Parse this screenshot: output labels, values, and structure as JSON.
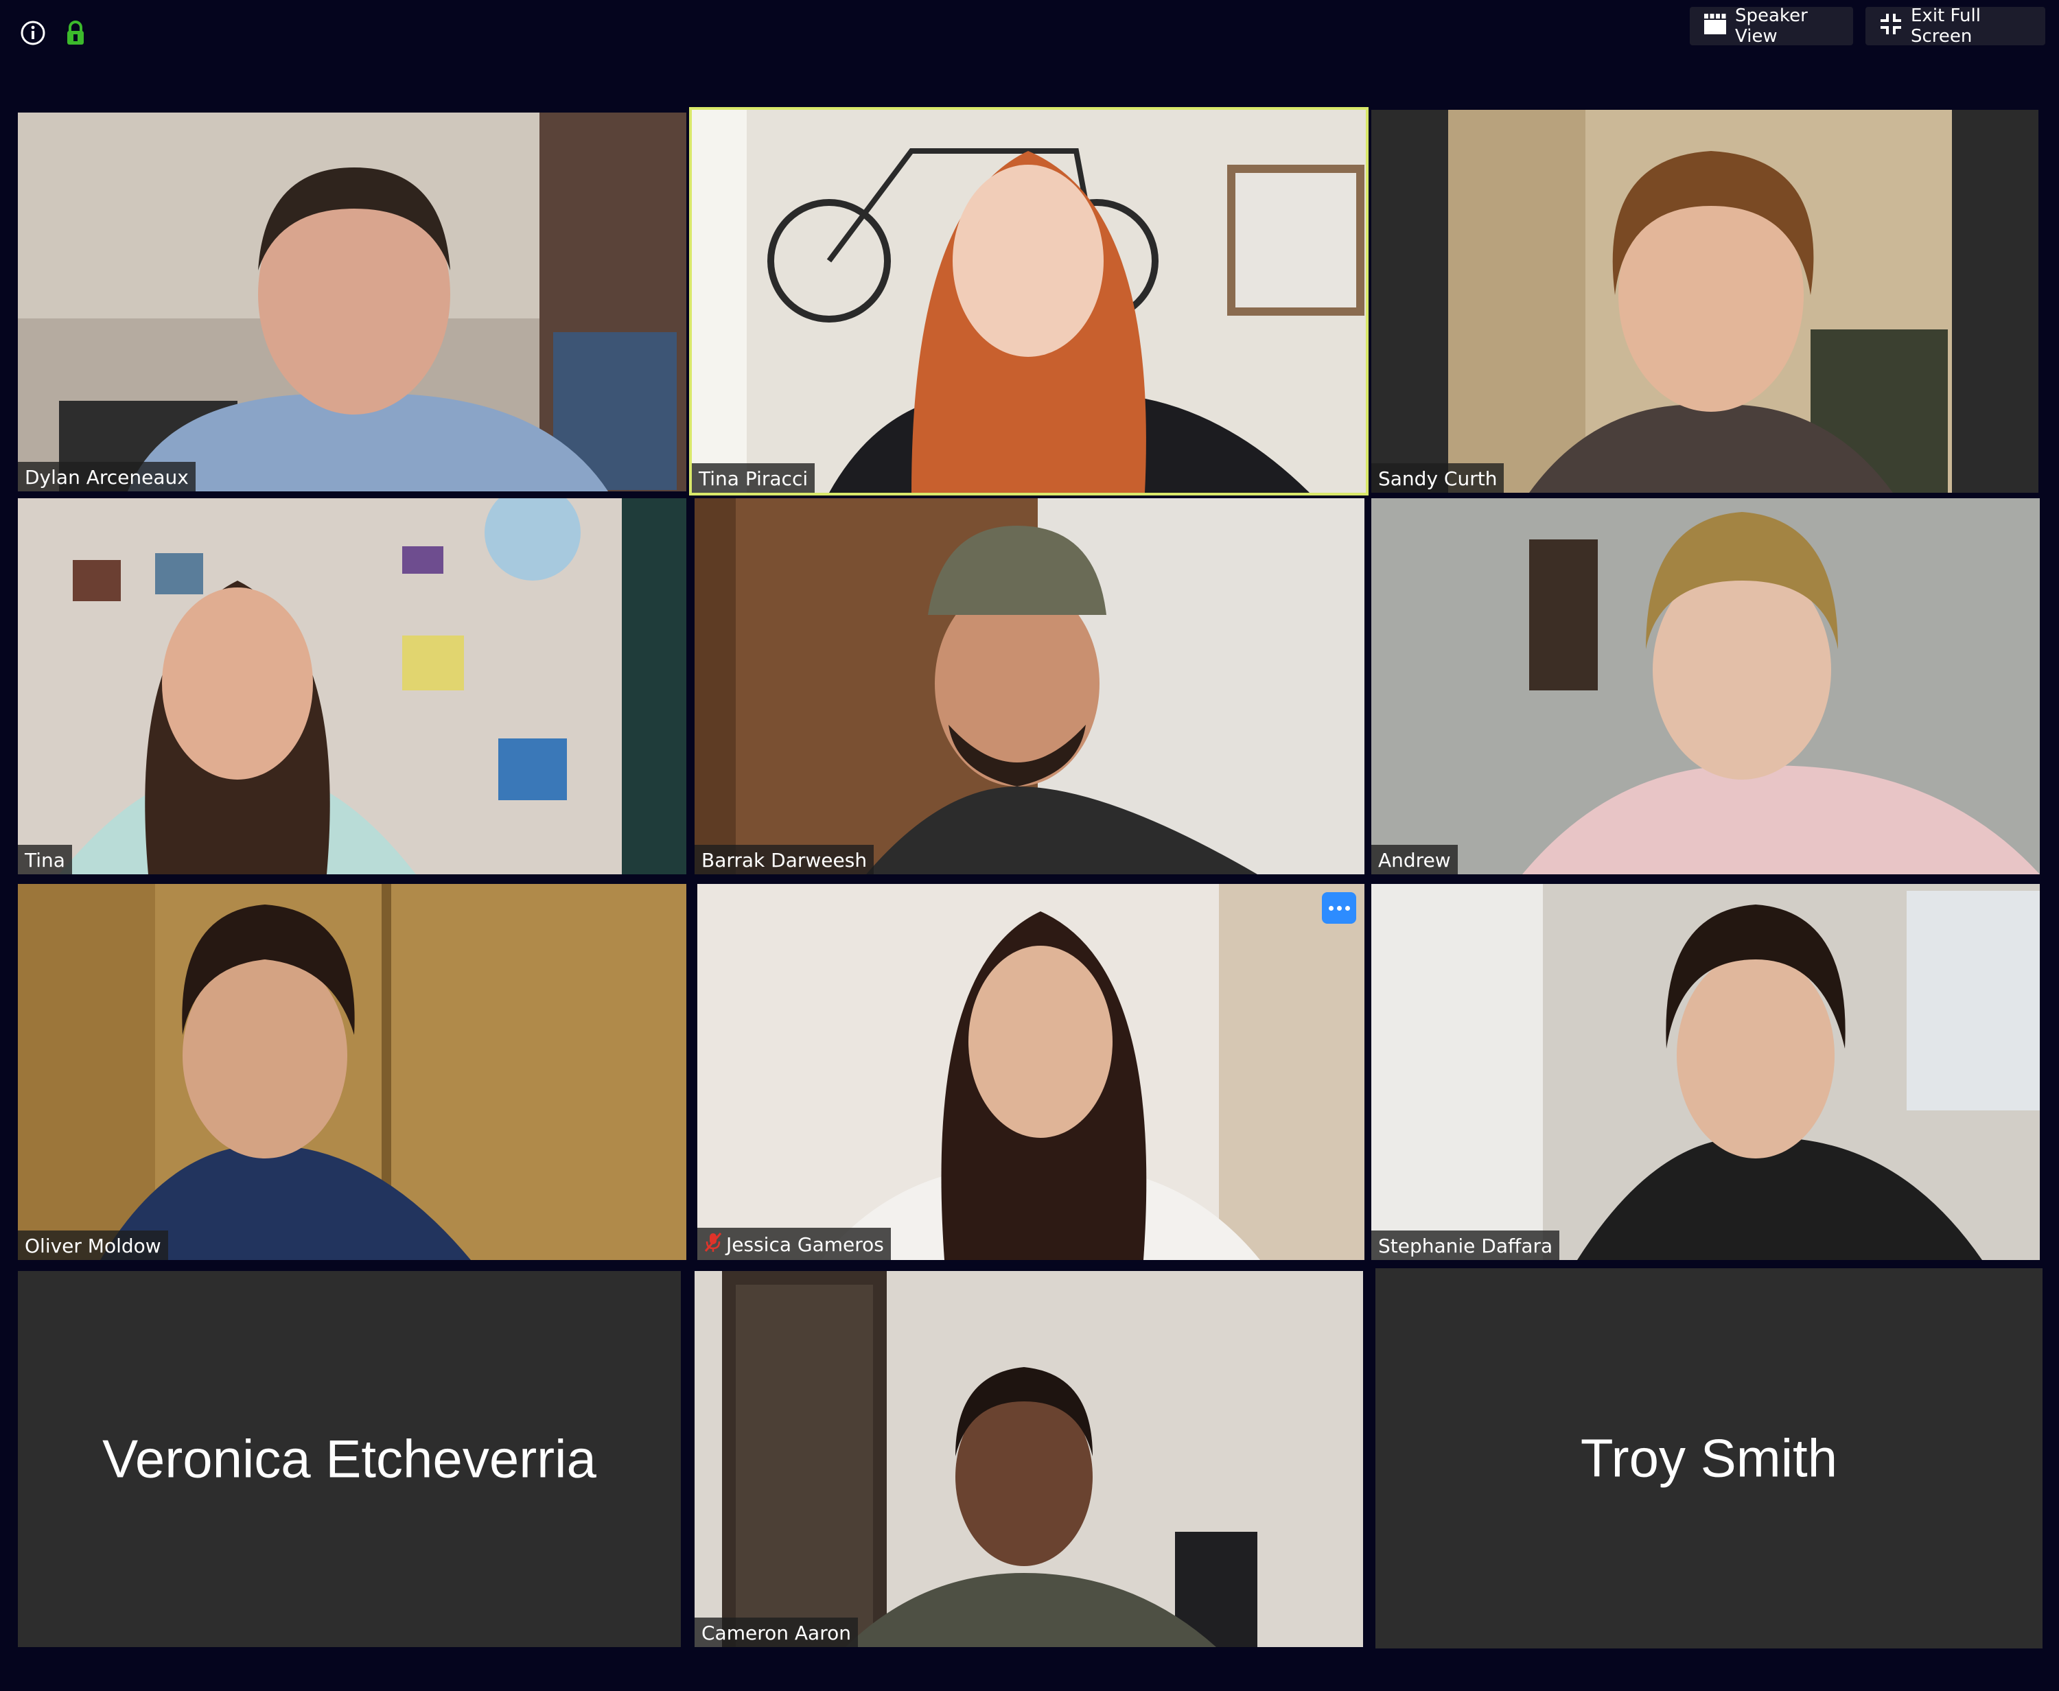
{
  "toolbar": {
    "speaker_view_label": "Speaker View",
    "exit_fullscreen_label": "Exit Full Screen"
  },
  "colors": {
    "background": "#05051e",
    "active_speaker_border": "#d9e86a",
    "placeholder_tile": "#2d2d2d",
    "accent": "#2d8cff",
    "encryption_green": "#3cba2c"
  },
  "participants": [
    {
      "name": "Dylan Arceneaux",
      "video": true
    },
    {
      "name": "Tina Piracci",
      "video": true,
      "active_speaker": true
    },
    {
      "name": "Sandy Curth",
      "video": true
    },
    {
      "name": "Tina",
      "video": true
    },
    {
      "name": "Barrak Darweesh",
      "video": true
    },
    {
      "name": "Andrew",
      "video": true
    },
    {
      "name": "Oliver Moldow",
      "video": true
    },
    {
      "name": "Jessica Gameros",
      "video": true,
      "muted": true
    },
    {
      "name": "Stephanie Daffara",
      "video": true
    },
    {
      "name": "Veronica Etcheverria",
      "video": false
    },
    {
      "name": "Cameron Aaron",
      "video": true
    },
    {
      "name": "Troy Smith",
      "video": false
    }
  ]
}
